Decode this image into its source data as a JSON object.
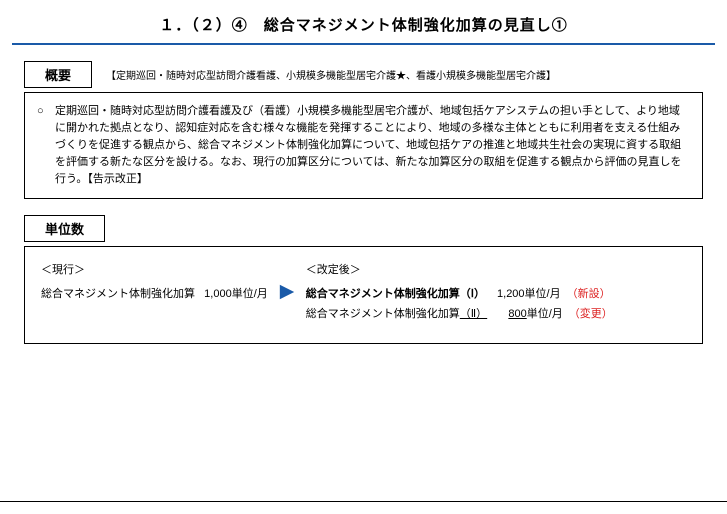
{
  "title": "１．（２）④　総合マネジメント体制強化加算の見直し①",
  "overview": {
    "label": "概要",
    "note": "【定期巡回・随時対応型訪問介護看護、小規模多機能型居宅介護★、看護小規模多機能型居宅介護】",
    "bullet": "○",
    "text": "定期巡回・随時対応型訪問介護看護及び（看護）小規模多機能型居宅介護が、地域包括ケアシステムの担い手として、より地域に開かれた拠点となり、認知症対応を含む様々な機能を発揮することにより、地域の多様な主体とともに利用者を支える仕組みづくりを促進する観点から、総合マネジメント体制強化加算について、地域包括ケアの推進と地域共生社会の実現に資する取組を評価する新たな区分を設ける。なお、現行の加算区分については、新たな加算区分の取組を促進する観点から評価の見直しを行う。【告示改正】"
  },
  "units": {
    "label": "単位数",
    "current": {
      "header": "＜現行＞",
      "name": "総合マネジメント体制強化加算",
      "value": "1,000単位/月"
    },
    "revised": {
      "header": "＜改定後＞",
      "rows": [
        {
          "name_bold": "総合マネジメント体制強化加算（Ⅰ）",
          "value": "1,200単位/月",
          "tag": "（新設）"
        },
        {
          "name_plain_prefix": "総合マネジメント体制強化加算",
          "name_underline": "（Ⅱ）",
          "value_underline": "800",
          "value_suffix": "単位/月",
          "tag": "（変更）"
        }
      ]
    }
  }
}
